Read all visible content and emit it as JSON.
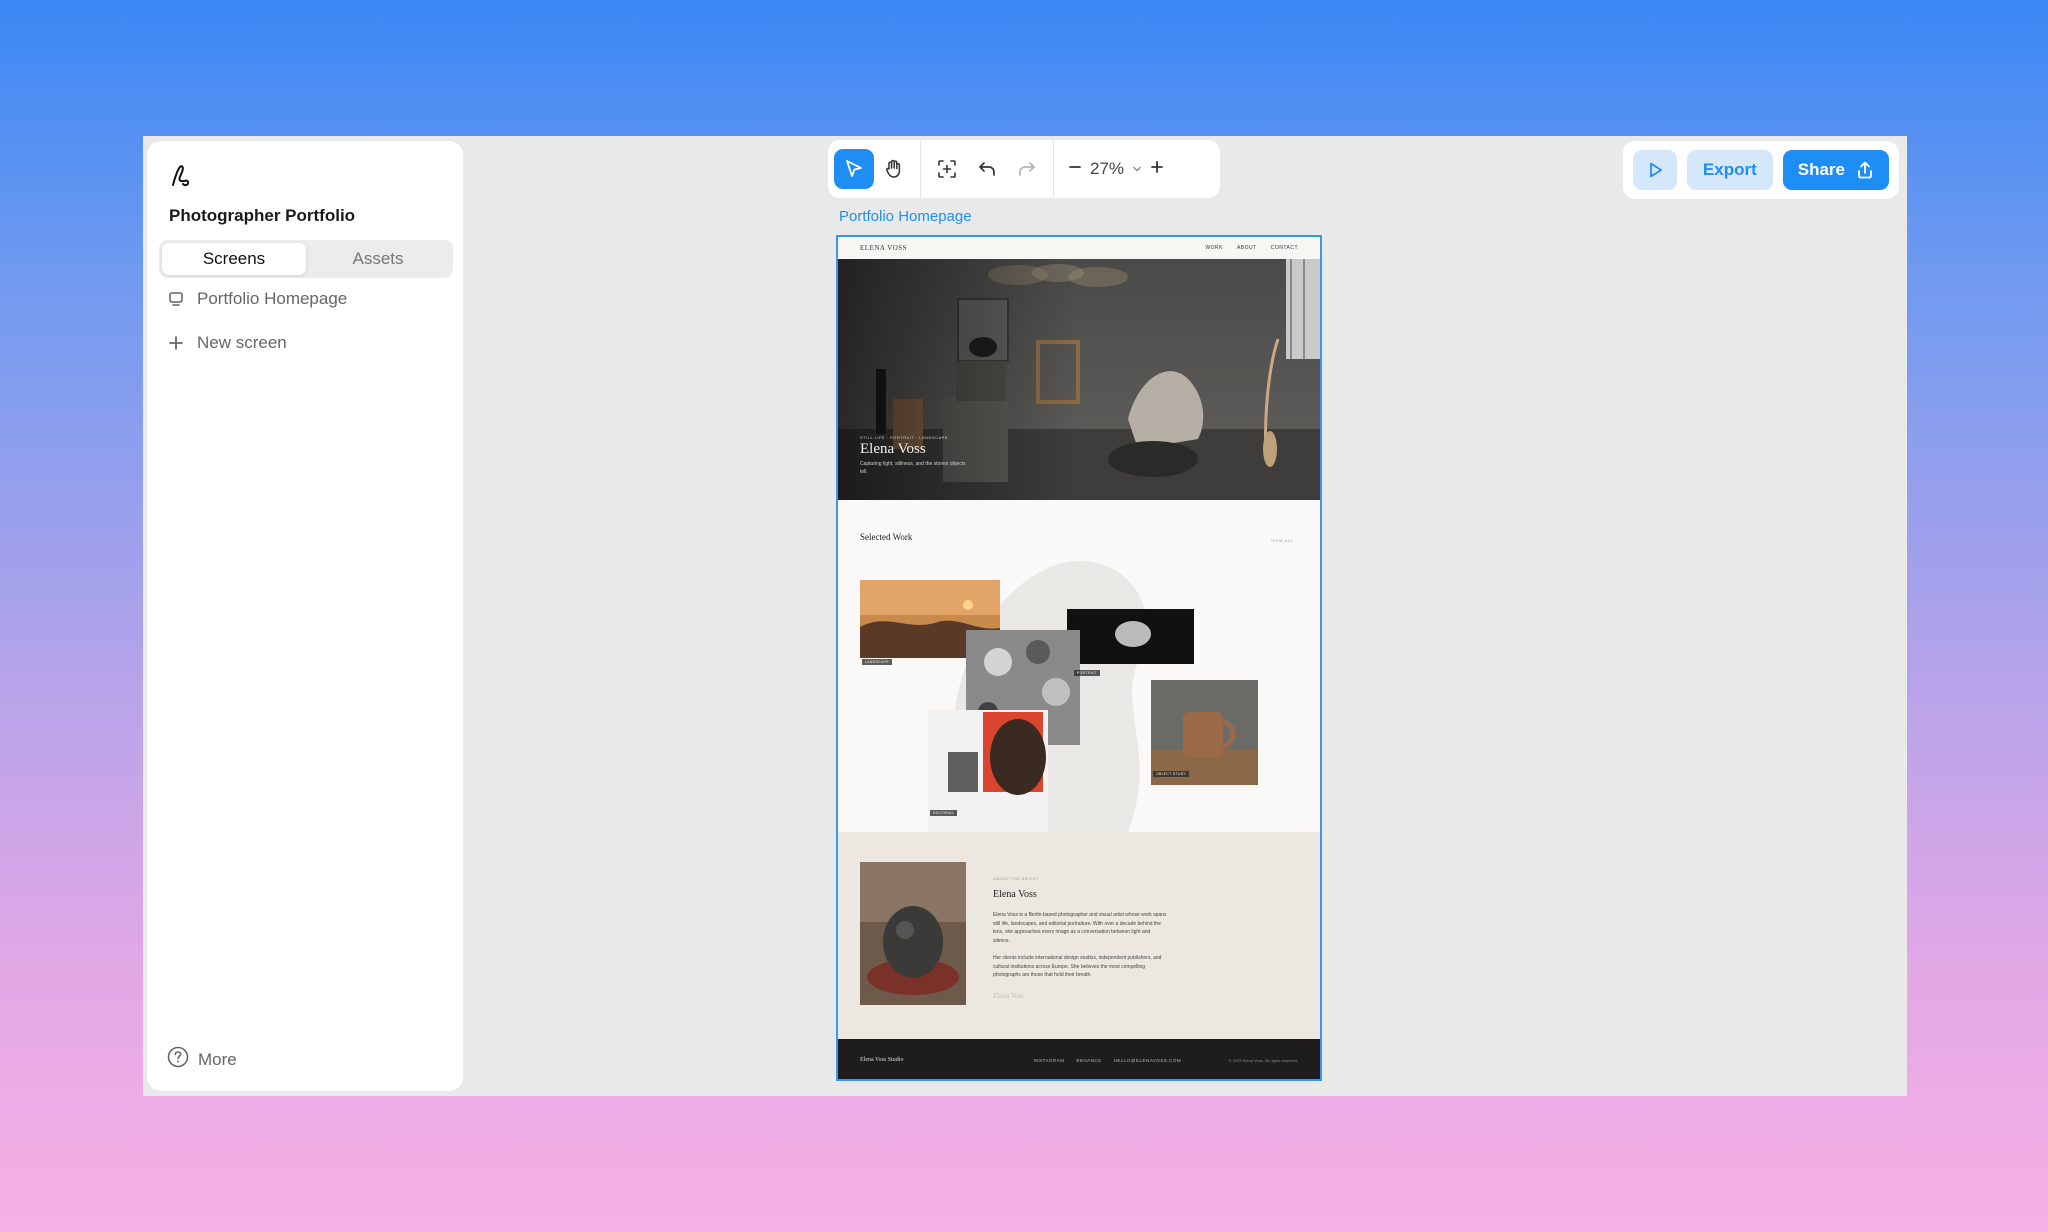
{
  "sidebar": {
    "project_title": "Photographer Portfolio",
    "tabs": [
      {
        "label": "Screens",
        "active": true
      },
      {
        "label": "Assets",
        "active": false
      }
    ],
    "screens": [
      {
        "label": "Portfolio Homepage",
        "icon": "monitor-icon"
      }
    ],
    "new_screen_label": "New screen",
    "more_label": "More"
  },
  "toolbar": {
    "tools": [
      "pointer-icon",
      "hand-icon",
      "fit-frame-icon",
      "undo-icon",
      "redo-icon"
    ],
    "zoom": "27%"
  },
  "actions": {
    "export_label": "Export",
    "share_label": "Share"
  },
  "canvas": {
    "frame_label": "Portfolio Homepage"
  },
  "preview": {
    "brand": "ELENA VOSS",
    "nav": [
      "WORK",
      "ABOUT",
      "CONTACT"
    ],
    "hero_kicker": "STILL LIFE · PORTRAIT · LANDSCAPE",
    "hero_name": "Elena Voss",
    "hero_sub": "Capturing light, stillness, and the stories objects tell.",
    "selected_work_title": "Selected Work",
    "view_all": "VIEW ALL",
    "work_tags": [
      "LANDSCAPE",
      "PORTRAIT",
      "EDITORIAL",
      "OBJECT STUDY"
    ],
    "about_kicker": "ABOUT THE ARTIST",
    "about_name": "Elena Voss",
    "about_p1": "Elena Voss is a Berlin-based photographer and visual artist whose work spans still life, landscapes, and editorial portraiture. With over a decade behind the lens, she approaches every image as a conversation between light and silence.",
    "about_p2": "Her clients include international design studios, independent publishers, and cultural institutions across Europe. She believes the most compelling photographs are those that hold their breath.",
    "about_signature": "Elena Voss",
    "footer_brand": "Elena Voss Studio",
    "footer_links": [
      "INSTAGRAM",
      "BEHANCE",
      "HELLO@ELENAVOSS.COM"
    ],
    "footer_copy": "© 2025 Elena Voss. All rights reserved."
  },
  "colors": {
    "accent": "#1e8ef5",
    "accent_soft": "#d5e8fb",
    "canvas_bg": "#e9e9e9"
  }
}
